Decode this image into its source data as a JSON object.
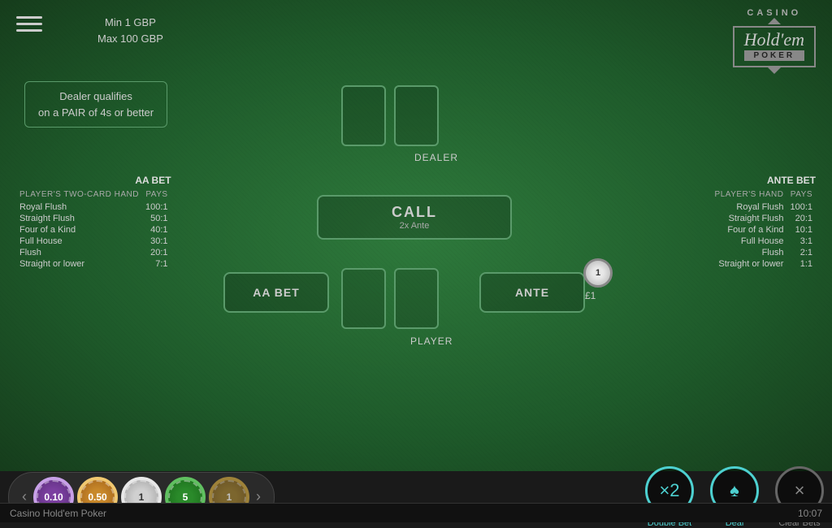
{
  "header": {
    "bet_limits_min": "Min 1 GBP",
    "bet_limits_max": "Max 100 GBP"
  },
  "logo": {
    "casino": "CASINO",
    "holdem": "Hold'em",
    "poker": "POKER"
  },
  "dealer_qualifier": {
    "line1": "Dealer qualifies",
    "line2": "on a PAIR of 4s or better"
  },
  "labels": {
    "dealer": "DEALER",
    "player": "PLAYER",
    "call": "CALL",
    "call_sub": "2x Ante",
    "aa_bet": "AA BET",
    "ante": "ANTE"
  },
  "aa_payout": {
    "title": "AA BET",
    "header_hand": "PLAYER'S TWO-CARD HAND",
    "header_pays": "PAYS",
    "rows": [
      {
        "hand": "Royal Flush",
        "pays": "100:1"
      },
      {
        "hand": "Straight Flush",
        "pays": "50:1"
      },
      {
        "hand": "Four of a Kind",
        "pays": "40:1"
      },
      {
        "hand": "Full House",
        "pays": "30:1"
      },
      {
        "hand": "Flush",
        "pays": "20:1"
      },
      {
        "hand": "Straight or lower",
        "pays": "7:1"
      }
    ]
  },
  "ante_payout": {
    "title": "ANTE BET",
    "header_hand": "PLAYER'S HAND",
    "header_pays": "PAYS",
    "rows": [
      {
        "hand": "Royal Flush",
        "pays": "100:1"
      },
      {
        "hand": "Straight Flush",
        "pays": "20:1"
      },
      {
        "hand": "Four of a Kind",
        "pays": "10:1"
      },
      {
        "hand": "Full House",
        "pays": "3:1"
      },
      {
        "hand": "Flush",
        "pays": "2:1"
      },
      {
        "hand": "Straight or lower",
        "pays": "1:1"
      }
    ]
  },
  "chip_on_ante": {
    "label": "1",
    "amount": "£1"
  },
  "chips": [
    {
      "value": "0.10",
      "class": "chip-010"
    },
    {
      "value": "0.50",
      "class": "chip-050"
    },
    {
      "value": "1",
      "class": "chip-1"
    },
    {
      "value": "5",
      "class": "chip-5"
    },
    {
      "value": "1",
      "class": "chip-partial"
    }
  ],
  "action_buttons": {
    "double_bet": {
      "label": "Double Bet",
      "symbol": "×2"
    },
    "deal": {
      "label": "Deal",
      "symbol": "♠"
    },
    "clear_bets": {
      "label": "Clear Bets",
      "symbol": "×"
    }
  },
  "status_bar": {
    "game_name": "Casino Hold'em Poker",
    "time": "10:07"
  }
}
